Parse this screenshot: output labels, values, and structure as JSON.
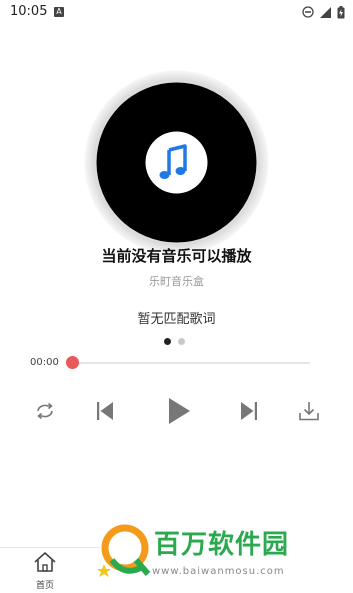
{
  "status_bar": {
    "time": "10:05",
    "app_badge": "A"
  },
  "player": {
    "song_title": "当前没有音乐可以播放",
    "artist": "乐町音乐盒",
    "lyrics": "暂无匹配歌词",
    "elapsed": "00:00",
    "progress": 0,
    "page_dots": 2,
    "active_page": 0
  },
  "bottom_nav": {
    "home_label": "首页"
  },
  "watermark": {
    "brand": "百万软件园",
    "url": "www.baiwanmosu.com"
  },
  "colors": {
    "accent": "#e85a5a",
    "disc": "#000000",
    "music_note": "#1e78e6",
    "watermark_green": "#2aa94f"
  }
}
